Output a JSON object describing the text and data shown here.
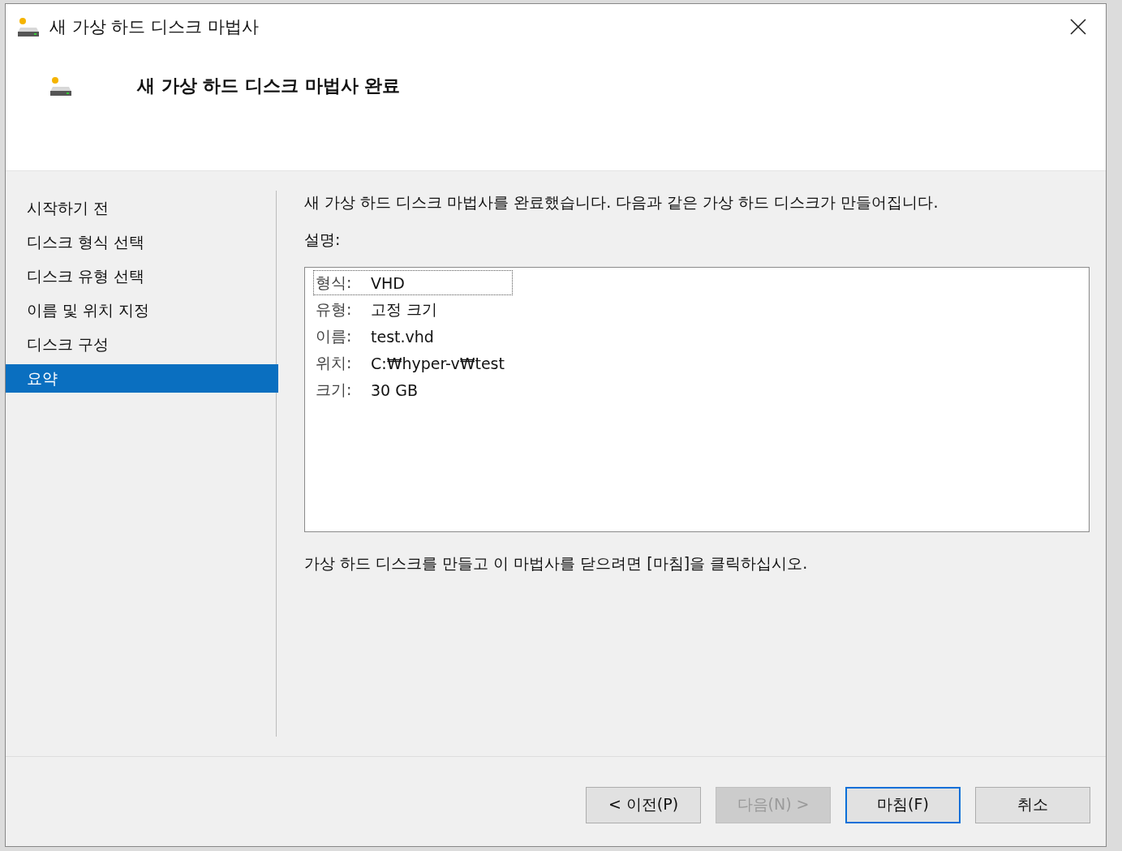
{
  "window": {
    "title": "새 가상 하드 디스크 마법사"
  },
  "header": {
    "title": "새 가상 하드 디스크 마법사 완료"
  },
  "steps": [
    {
      "label": "시작하기 전",
      "selected": false
    },
    {
      "label": "디스크 형식 선택",
      "selected": false
    },
    {
      "label": "디스크 유형 선택",
      "selected": false
    },
    {
      "label": "이름 및 위치 지정",
      "selected": false
    },
    {
      "label": "디스크 구성",
      "selected": false
    },
    {
      "label": "요약",
      "selected": true
    }
  ],
  "intro": "새 가상 하드 디스크 마법사를 완료했습니다. 다음과 같은 가상 하드 디스크가 만들어집니다.",
  "description_label": "설명:",
  "summary": [
    {
      "label": "형식:",
      "value": "VHD",
      "focused": true
    },
    {
      "label": "유형:",
      "value": "고정 크기",
      "focused": false
    },
    {
      "label": "이름:",
      "value": "test.vhd",
      "focused": false
    },
    {
      "label": "위치:",
      "value": "C:₩hyper-v₩test",
      "focused": false
    },
    {
      "label": "크기:",
      "value": "30 GB",
      "focused": false
    }
  ],
  "instruction": "가상 하드 디스크를 만들고 이 마법사를 닫으려면 [마침]을 클릭하십시오.",
  "buttons": [
    {
      "label": "< 이전(P)",
      "disabled": false,
      "default": false
    },
    {
      "label": "다음(N) >",
      "disabled": true,
      "default": false
    },
    {
      "label": "마침(F)",
      "disabled": false,
      "default": true
    },
    {
      "label": "취소",
      "disabled": false,
      "default": false
    }
  ]
}
